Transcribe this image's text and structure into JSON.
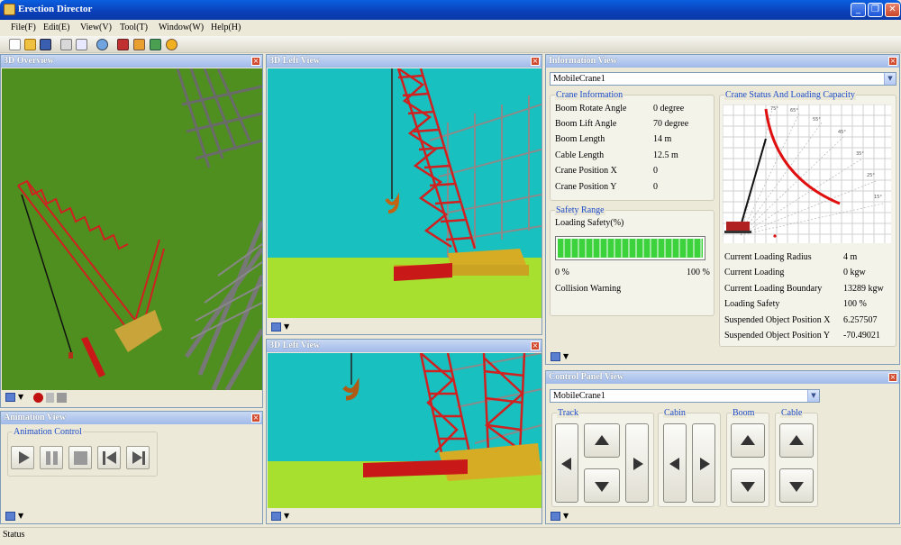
{
  "window": {
    "title": "Erection Director",
    "min": "_",
    "max": "❐",
    "close": "✕"
  },
  "menu": [
    "File(F)",
    "Edit(E)",
    "View(V)",
    "Tool(T)",
    "Window(W)",
    "Help(H)"
  ],
  "panels": {
    "overview": {
      "title": "3D Overview"
    },
    "left_top": {
      "title": "3D Left View"
    },
    "left_bottom": {
      "title": "3D Left View"
    },
    "animation": {
      "title": "Animation View",
      "group": "Animation Control"
    },
    "info": {
      "title": "Information View"
    },
    "control": {
      "title": "Control Panel View"
    }
  },
  "info": {
    "crane_select": "MobileCrane1",
    "crane_info_title": "Crane Information",
    "fields": [
      {
        "label": "Boom Rotate Angle",
        "value": "0 degree"
      },
      {
        "label": "Boom Lift Angle",
        "value": "70 degree"
      },
      {
        "label": "Boom Length",
        "value": "14 m"
      },
      {
        "label": "Cable Length",
        "value": "12.5 m"
      },
      {
        "label": "Crane Position X",
        "value": "0"
      },
      {
        "label": "Crane Position Y",
        "value": "0"
      }
    ],
    "safety_title": "Safety Range",
    "loading_safety_label": "Loading Safety(%)",
    "safety_level": 1.0,
    "range_min": "0 %",
    "range_max": "100 %",
    "collision_warning": "Collision Warning",
    "status_title": "Crane Status And Loading Capacity",
    "status_fields": [
      {
        "label": "Current Loading Radius",
        "value": "4 m"
      },
      {
        "label": "Current Loading",
        "value": "0 kgw"
      },
      {
        "label": "Current Loading Boundary",
        "value": "13289 kgw"
      },
      {
        "label": "Loading Safety",
        "value": "100 %"
      },
      {
        "label": "Suspended Object Position X",
        "value": "6.257507"
      },
      {
        "label": "Suspended Object Position Y",
        "value": "-70.49021"
      }
    ],
    "chart_angles": [
      "75°",
      "65°",
      "55°",
      "45°",
      "35°",
      "25°",
      "15°"
    ]
  },
  "control": {
    "crane_select": "MobileCrane1",
    "groups": [
      "Track",
      "Cabin",
      "Boom",
      "Cable"
    ]
  },
  "status_text": "Status"
}
